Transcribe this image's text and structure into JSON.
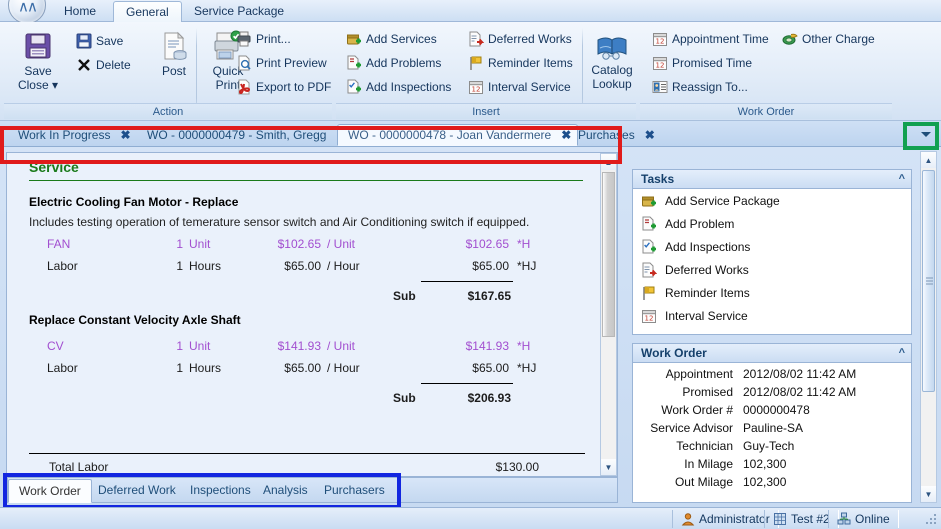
{
  "app": {
    "orb_icon": "app-orb-icon"
  },
  "ribbon_tabs": [
    {
      "label": "Home",
      "active": false
    },
    {
      "label": "General",
      "active": true
    },
    {
      "label": "Service Package",
      "active": false
    }
  ],
  "ribbon_groups": [
    {
      "label": "Action",
      "big_buttons": [
        {
          "label_line1": "Save",
          "label_line2": "Close ▾",
          "icon": "save-floppy-icon"
        },
        {
          "label_line1": "Post",
          "label_line2": "",
          "icon": "post-document-icon"
        },
        {
          "label_line1": "Quick",
          "label_line2": "Print",
          "icon": "quick-print-icon"
        }
      ],
      "small_buttons": [
        {
          "label": "Save",
          "icon": "save-icon"
        },
        {
          "label": "Delete",
          "icon": "delete-x-icon"
        },
        {
          "label": "Print...",
          "icon": "printer-icon"
        },
        {
          "label": "Print Preview",
          "icon": "print-preview-icon"
        },
        {
          "label": "Export to PDF",
          "icon": "pdf-icon"
        }
      ]
    },
    {
      "label": "Insert",
      "small_buttons": [
        {
          "label": "Add Services",
          "icon": "add-services-icon"
        },
        {
          "label": "Add Problems",
          "icon": "add-problems-icon"
        },
        {
          "label": "Add Inspections",
          "icon": "add-inspections-icon"
        },
        {
          "label": "Deferred Works",
          "icon": "deferred-works-icon"
        },
        {
          "label": "Reminder Items",
          "icon": "reminder-flag-icon"
        },
        {
          "label": "Interval Service",
          "icon": "calendar-icon"
        }
      ],
      "big_buttons": [
        {
          "label_line1": "Catalog",
          "label_line2": "Lookup",
          "icon": "catalog-book-icon"
        }
      ]
    },
    {
      "label": "Work Order",
      "small_buttons": [
        {
          "label": "Appointment Time",
          "icon": "calendar-icon"
        },
        {
          "label": "Promised Time",
          "icon": "calendar-icon"
        },
        {
          "label": "Reassign To...",
          "icon": "reassign-contact-icon"
        },
        {
          "label": "Other Charge",
          "icon": "other-charge-money-icon"
        }
      ]
    }
  ],
  "document_tabs": {
    "items": [
      {
        "label": "Work In Progress",
        "active": false,
        "close_icon": "close-x-icon"
      },
      {
        "label": "WO - 0000000479 - Smith, Gregg",
        "active": false,
        "close_icon": "close-x-icon"
      },
      {
        "label": "WO - 0000000478 - Joan Vandermere",
        "active": true,
        "close_icon": "close-x-icon"
      },
      {
        "label": "Purchases",
        "active": false,
        "close_icon": "close-x-icon"
      }
    ],
    "overflow_icon": "chevron-down-icon"
  },
  "service": {
    "section_title": "Service",
    "jobs": [
      {
        "title": "Electric Cooling Fan Motor - Replace",
        "description": "Includes testing operation of temerature sensor switch and Air Conditioning switch if equipped.",
        "lines": [
          {
            "name": "FAN",
            "qty": "1",
            "unit": "Unit",
            "price": "$102.65",
            "per": "/ Unit",
            "ext": "$102.65",
            "tag": "*H",
            "kind": "part"
          },
          {
            "name": "Labor",
            "qty": "1",
            "unit": "Hours",
            "price": "$65.00",
            "per": "/ Hour",
            "ext": "$65.00",
            "tag": "*HJ",
            "kind": "labor"
          }
        ],
        "sub_label": "Sub",
        "sub_value": "$167.65"
      },
      {
        "title": "Replace Constant Velocity Axle Shaft",
        "description": "",
        "lines": [
          {
            "name": "CV",
            "qty": "1",
            "unit": "Unit",
            "price": "$141.93",
            "per": "/ Unit",
            "ext": "$141.93",
            "tag": "*H",
            "kind": "part"
          },
          {
            "name": "Labor",
            "qty": "1",
            "unit": "Hours",
            "price": "$65.00",
            "per": "/ Hour",
            "ext": "$65.00",
            "tag": "*HJ",
            "kind": "labor"
          }
        ],
        "sub_label": "Sub",
        "sub_value": "$206.93"
      }
    ],
    "total_label": "Total Labor",
    "total_value": "$130.00"
  },
  "bottom_tabs": [
    {
      "label": "Work Order",
      "active": true
    },
    {
      "label": "Deferred Work",
      "active": false
    },
    {
      "label": "Inspections",
      "active": false
    },
    {
      "label": "Analysis",
      "active": false
    },
    {
      "label": "Purchasers",
      "active": false
    }
  ],
  "tasks_pane": {
    "title": "Tasks",
    "collapse_icon": "chevron-up-icon",
    "items": [
      {
        "label": "Add Service Package",
        "icon": "add-services-icon"
      },
      {
        "label": "Add Problem",
        "icon": "add-problems-icon"
      },
      {
        "label": "Add Inspections",
        "icon": "add-inspections-icon"
      },
      {
        "label": "Deferred Works",
        "icon": "deferred-works-icon"
      },
      {
        "label": "Reminder Items",
        "icon": "reminder-flag-icon"
      },
      {
        "label": "Interval Service",
        "icon": "calendar-icon"
      }
    ]
  },
  "work_order_pane": {
    "title": "Work Order",
    "collapse_icon": "chevron-up-icon",
    "fields": [
      {
        "label": "Appointment",
        "value": "2012/08/02 11:42 AM"
      },
      {
        "label": "Promised",
        "value": "2012/08/02 11:42 AM"
      },
      {
        "label": "Work Order #",
        "value": "0000000478"
      },
      {
        "label": "Service Advisor",
        "value": "Pauline-SA"
      },
      {
        "label": "Technician",
        "value": "Guy-Tech"
      },
      {
        "label": "In Milage",
        "value": "102,300"
      },
      {
        "label": "Out Milage",
        "value": "102,300"
      }
    ]
  },
  "statusbar": {
    "cells": [
      {
        "label": "Administrator",
        "icon": "user-icon"
      },
      {
        "label": "Test #2",
        "icon": "database-icon"
      },
      {
        "label": "Online",
        "icon": "network-online-icon"
      }
    ],
    "grip_icon": "resize-grip-icon"
  },
  "annotations": [
    {
      "name": "document-tabs-highlight",
      "color": "#e01b1b"
    },
    {
      "name": "tab-overflow-highlight",
      "color": "#11a050"
    },
    {
      "name": "bottom-tabs-highlight",
      "color": "#1226e0"
    }
  ],
  "colors": {
    "part_text": "#a24fd0",
    "section_green": "#1a7a1a",
    "link_blue": "#15355c"
  }
}
